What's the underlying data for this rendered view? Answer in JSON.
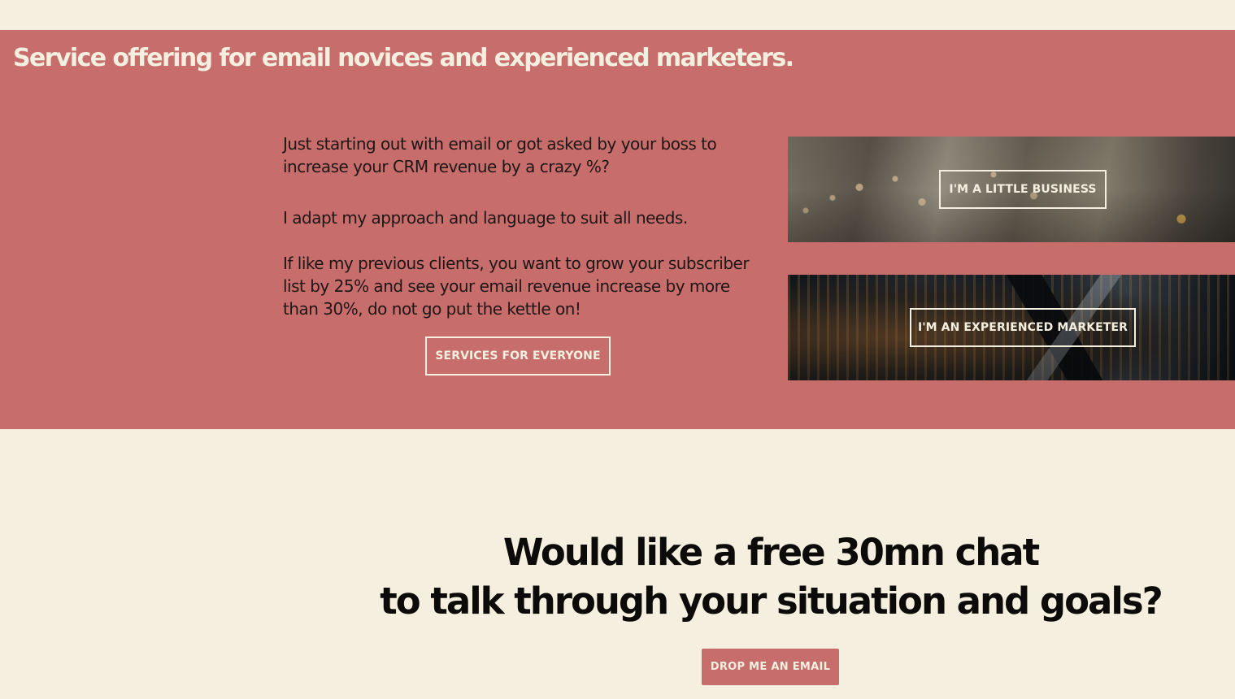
{
  "services": {
    "heading": "Service offering for email novices and experienced marketers.",
    "paragraphs": [
      "Just starting out with email or got asked by your boss to increase your CRM revenue by a crazy %?",
      "I adapt my approach and language to suit all needs.",
      "If like my previous clients, you want to grow your subscriber list by 25% and see your email revenue increase by more than 30%, do not go put the kettle on!"
    ],
    "button_label": "SERVICES FOR EVERYONE",
    "tiles": [
      {
        "button_label": "I'M A LITTLE BUSINESS"
      },
      {
        "button_label": "I'M AN EXPERIENCED MARKETER"
      }
    ]
  },
  "chat": {
    "heading_line1": "Would like a free 30mn chat",
    "heading_line2": "to talk through your situation and goals?",
    "button_label": "DROP ME AN EMAIL"
  },
  "colors": {
    "background": "#f5efdf",
    "accent": "#c76d6c",
    "text": "#1a1412"
  }
}
